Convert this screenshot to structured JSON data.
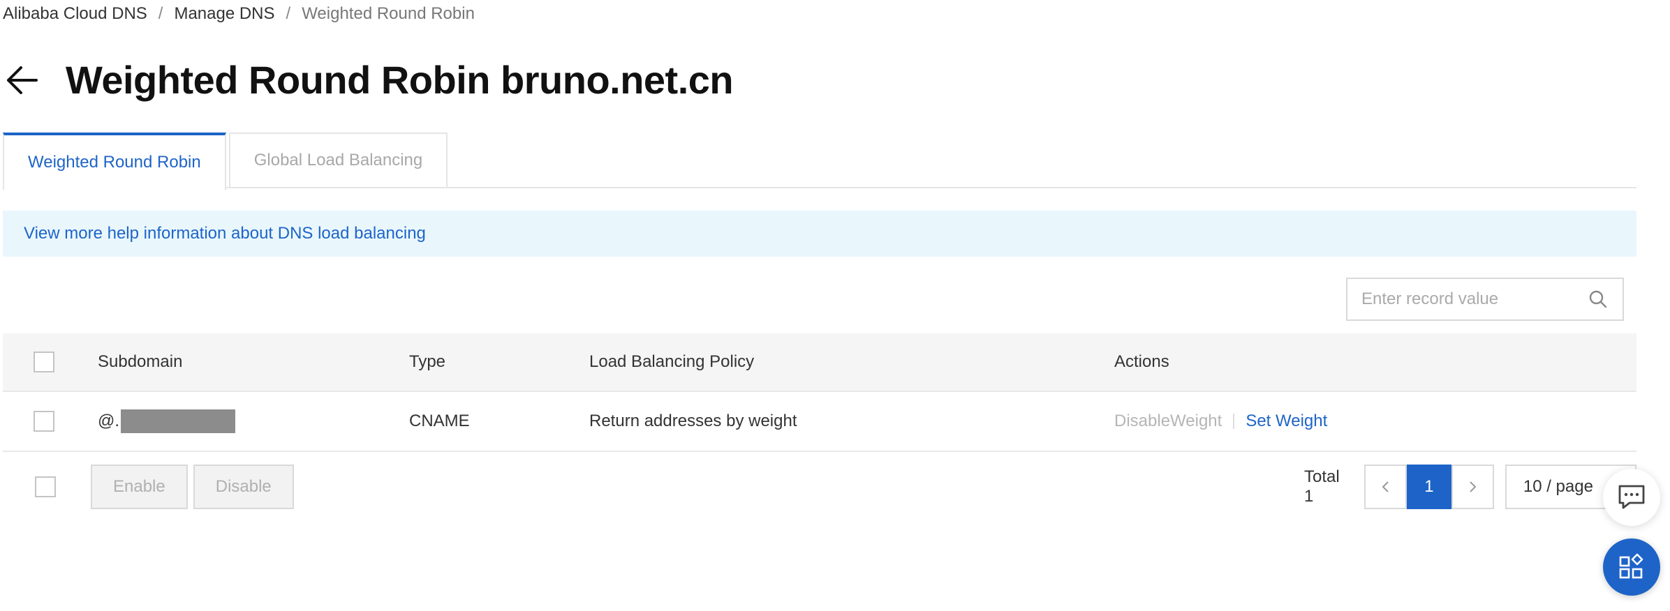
{
  "breadcrumb": {
    "items": [
      "Alibaba Cloud DNS",
      "Manage DNS"
    ],
    "current": "Weighted Round Robin",
    "separator": "/"
  },
  "header": {
    "title": "Weighted Round Robin bruno.net.cn"
  },
  "tabs": [
    {
      "label": "Weighted Round Robin",
      "active": true
    },
    {
      "label": "Global Load Balancing",
      "active": false
    }
  ],
  "help": {
    "link_text": "View more help information about DNS load balancing"
  },
  "search": {
    "placeholder": "Enter record value"
  },
  "table": {
    "columns": [
      "Subdomain",
      "Type",
      "Load Balancing Policy",
      "Actions"
    ],
    "rows": [
      {
        "subdomain": "@.",
        "type": "CNAME",
        "policy": "Return addresses by weight",
        "actions": {
          "disable": "DisableWeight",
          "set": "Set Weight"
        }
      }
    ]
  },
  "footer": {
    "enable_label": "Enable",
    "disable_label": "Disable",
    "total": "Total 1",
    "current_page": "1",
    "page_size": "10 / page"
  },
  "colors": {
    "accent": "#1e64c8",
    "banner_bg": "#e9f7fd"
  }
}
